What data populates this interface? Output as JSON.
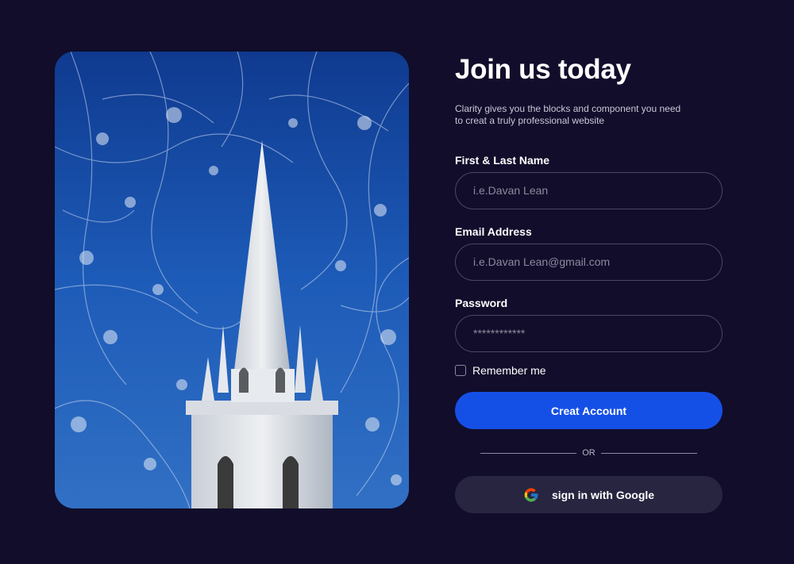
{
  "hero": {
    "image_description_icon": "church-spire-photo"
  },
  "form": {
    "title": "Join us today",
    "subtitle": "Clarity gives you the blocks and component you need to creat a truly professional website",
    "name_label": "First & Last Name",
    "name_placeholder": "i.e.Davan Lean",
    "email_label": "Email Address",
    "email_placeholder": "i.e.Davan Lean@gmail.com",
    "password_label": "Password",
    "password_placeholder": "************",
    "remember_label": "Remember me",
    "remember_checked": false,
    "submit_label": "Creat Account",
    "divider_text": "OR",
    "google_label": "sign in with Google"
  },
  "colors": {
    "background": "#110d2b",
    "primary": "#1550e6",
    "google_button": "#272540"
  }
}
